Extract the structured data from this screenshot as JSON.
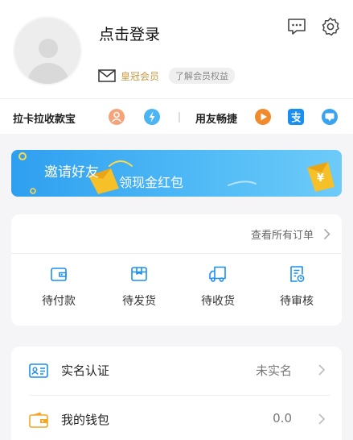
{
  "header": {
    "login_label": "点击登录",
    "member_label": "皇冠会员",
    "member_benefits": "了解会员权益",
    "icons": [
      "message-icon",
      "settings-icon",
      "mail-icon"
    ]
  },
  "services": {
    "group1_label": "拉卡拉收款宝",
    "group2_label": "用友畅捷",
    "icons": [
      "user-service-icon",
      "lightning-icon",
      "play-icon",
      "alipay-icon",
      "chat-bubble-icon"
    ]
  },
  "banner": {
    "line1": "邀请好友",
    "line2": "领现金红包",
    "coin_symbol": "¥"
  },
  "orders": {
    "view_all": "查看所有订单",
    "items": [
      {
        "label": "待付款",
        "icon": "wallet-icon"
      },
      {
        "label": "待发货",
        "icon": "package-icon"
      },
      {
        "label": "待收货",
        "icon": "truck-icon"
      },
      {
        "label": "待审核",
        "icon": "review-icon"
      }
    ]
  },
  "account": {
    "rows": [
      {
        "label": "实名认证",
        "value": "未实名",
        "icon": "id-card-icon"
      },
      {
        "label": "我的钱包",
        "value": "0.0",
        "icon": "wallet-fill-icon"
      }
    ]
  },
  "colors": {
    "accent": "#1a8ff2",
    "gold": "#c69a46",
    "orange": "#f5a623"
  }
}
